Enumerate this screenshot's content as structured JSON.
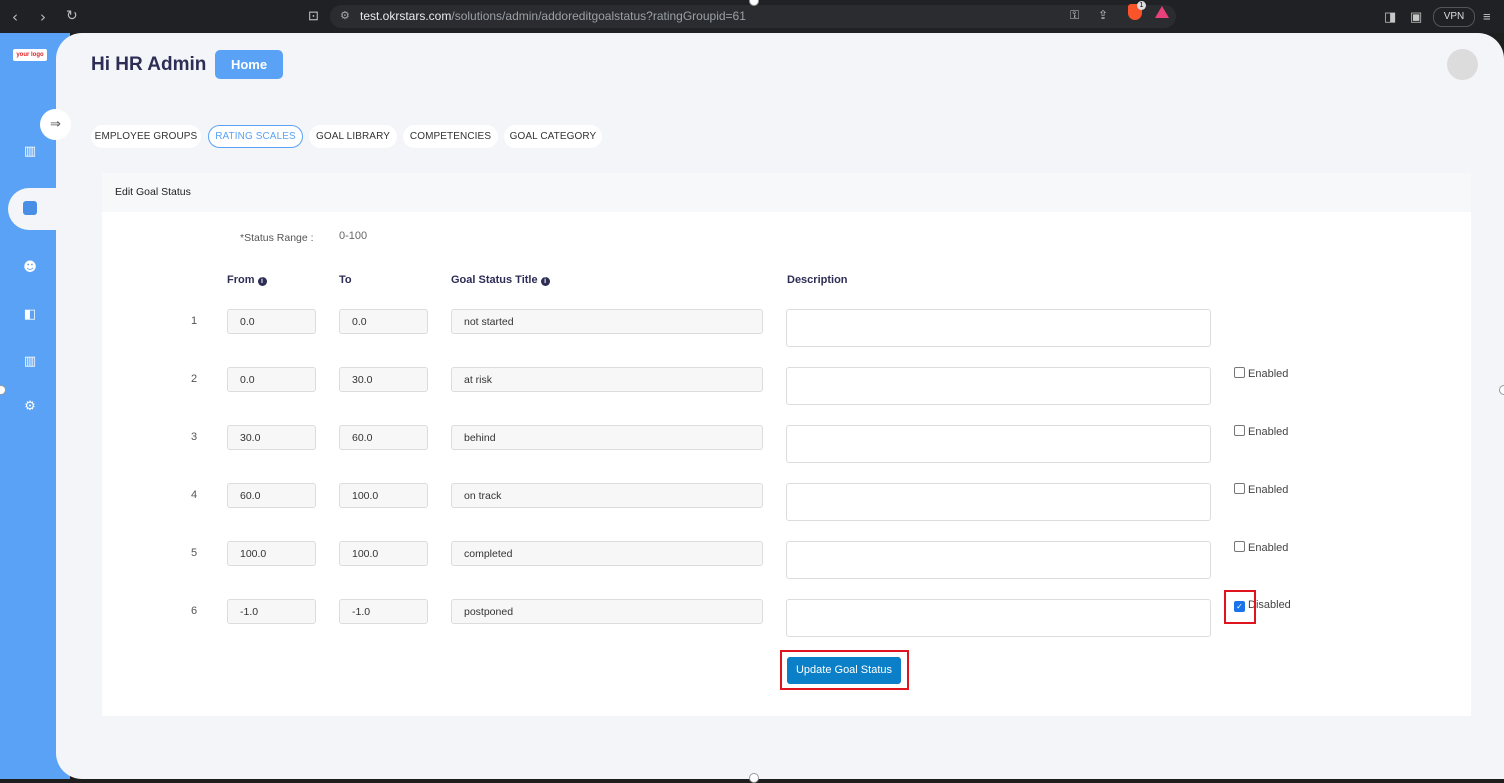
{
  "browser": {
    "url_host": "test.okrstars.com",
    "url_path": "/solutions/admin/addoreditgoalstatus?ratingGroupid=61",
    "vpn_label": "VPN",
    "brave_badge": "1"
  },
  "sidebar": {
    "logo_text": "your logo"
  },
  "header": {
    "greeting": "Hi HR Admin",
    "home_label": "Home"
  },
  "tabs": [
    {
      "label": "EMPLOYEE GROUPS"
    },
    {
      "label": "RATING SCALES"
    },
    {
      "label": "GOAL LIBRARY"
    },
    {
      "label": "COMPETENCIES"
    },
    {
      "label": "GOAL CATEGORY"
    }
  ],
  "form": {
    "title": "Edit Goal Status",
    "status_range_label": "*Status Range :",
    "status_range_value": "0-100",
    "columns": {
      "from": "From",
      "to": "To",
      "title": "Goal Status Title",
      "description": "Description"
    },
    "rows": [
      {
        "num": "1",
        "from": "0.0",
        "to": "0.0",
        "title": "not started",
        "description": "",
        "toggle_label": "",
        "checked": false
      },
      {
        "num": "2",
        "from": "0.0",
        "to": "30.0",
        "title": "at risk",
        "description": "",
        "toggle_label": "Enabled",
        "checked": false
      },
      {
        "num": "3",
        "from": "30.0",
        "to": "60.0",
        "title": "behind",
        "description": "",
        "toggle_label": "Enabled",
        "checked": false
      },
      {
        "num": "4",
        "from": "60.0",
        "to": "100.0",
        "title": "on track",
        "description": "",
        "toggle_label": "Enabled",
        "checked": false
      },
      {
        "num": "5",
        "from": "100.0",
        "to": "100.0",
        "title": "completed",
        "description": "",
        "toggle_label": "Enabled",
        "checked": false
      },
      {
        "num": "6",
        "from": "-1.0",
        "to": "-1.0",
        "title": "postponed",
        "description": "",
        "toggle_label": "Disabled",
        "checked": true
      }
    ],
    "submit_label": "Update Goal Status"
  }
}
